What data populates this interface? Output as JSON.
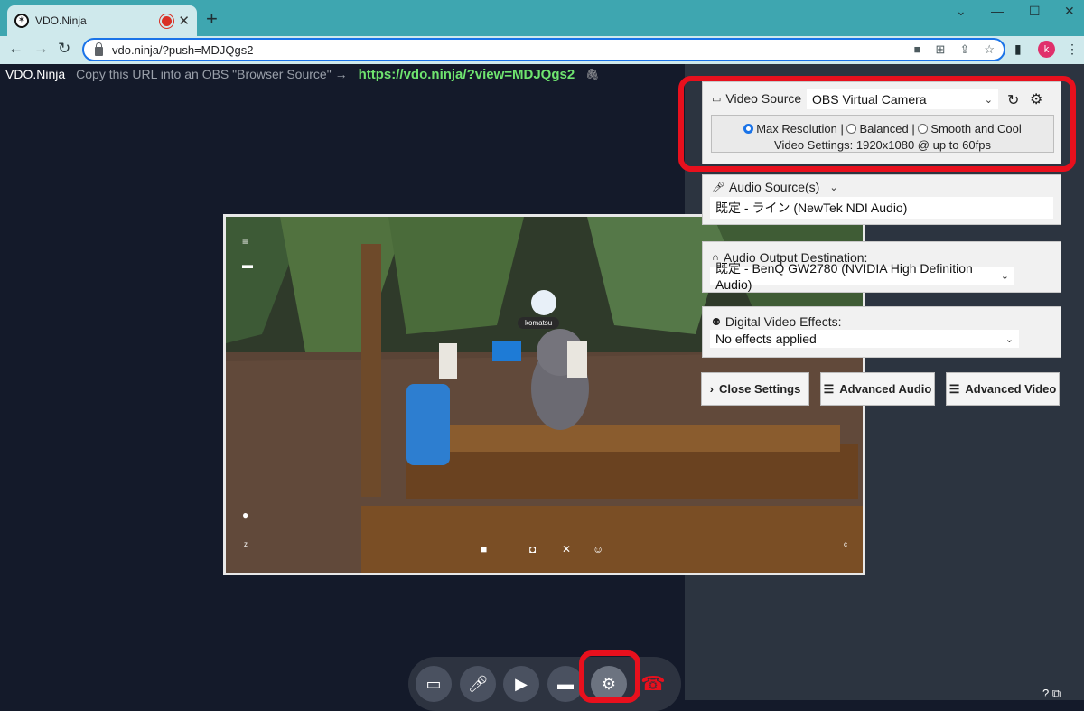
{
  "browser": {
    "tab_title": "VDO.Ninja",
    "tab_close": "✕",
    "new_tab": "+",
    "url": "vdo.ninja/?push=MDJQgs2",
    "profile_initial": "k"
  },
  "app": {
    "brand": "VDO.Ninja",
    "copy_hint": "Copy this URL into an OBS \"Browser Source\" →",
    "view_url": "https://vdo.ninja/?view=MDJQgs2"
  },
  "video_preview": {
    "username": "komatsu"
  },
  "settings": {
    "video_source": {
      "label": "Video Source",
      "value": "OBS Virtual Camera",
      "modes": [
        "Max Resolution",
        "Balanced",
        "Smooth and Cool"
      ],
      "selected_mode": "Max Resolution",
      "mode_separator": "|",
      "settings_text": "Video Settings: 1920x1080 @ up to 60fps"
    },
    "audio_source": {
      "label": "Audio Source(s)",
      "value": "既定 - ライン (NewTek NDI Audio)"
    },
    "audio_output": {
      "label": "Audio Output Destination:",
      "value": "既定 - BenQ GW2780 (NVIDIA High Definition Audio)"
    },
    "effects": {
      "label": "Digital Video Effects:",
      "value": "No effects applied"
    },
    "buttons": {
      "close": "Close Settings",
      "advanced_audio": "Advanced Audio",
      "advanced_video": "Advanced Video"
    }
  },
  "controls": [
    "chat-icon",
    "microphone-icon",
    "camera-icon",
    "screen-share-icon",
    "settings-gear-icon",
    "hangup-icon"
  ],
  "colors": {
    "highlight": "#e8101d",
    "url_green": "#6fe46f",
    "tab_bar": "#3ea6b0"
  }
}
